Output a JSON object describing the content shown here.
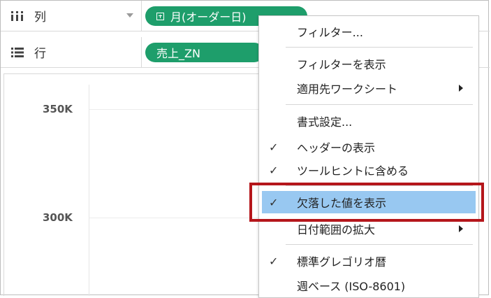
{
  "columns_shelf": {
    "label": "列",
    "pill": "月(オーダー日)"
  },
  "rows_shelf": {
    "label": "行",
    "pill": "売上_ZN"
  },
  "chart": {
    "y_ticks": [
      "350K",
      "300K"
    ]
  },
  "context_menu": {
    "items": [
      {
        "label": "フィルター...",
        "checked": false
      },
      {
        "label": "フィルターを表示",
        "checked": false
      },
      {
        "label": "適用先ワークシート",
        "checked": false,
        "submenu": true
      },
      {
        "label": "書式設定...",
        "checked": false
      },
      {
        "label": "ヘッダーの表示",
        "checked": true
      },
      {
        "label": "ツールヒントに含める",
        "checked": true
      },
      {
        "label": "欠落した値を表示",
        "checked": true,
        "highlighted": true
      },
      {
        "label": "日付範囲の拡大",
        "checked": false,
        "submenu": true
      },
      {
        "label": "標準グレゴリオ暦",
        "checked": true
      },
      {
        "label": "週ベース (ISO-8601)",
        "checked": false
      }
    ],
    "check_glyph": "✓"
  },
  "colors": {
    "pill_green": "#1e9e6b",
    "highlight_blue": "#98c8f1",
    "annotation_red": "#b5161b"
  }
}
